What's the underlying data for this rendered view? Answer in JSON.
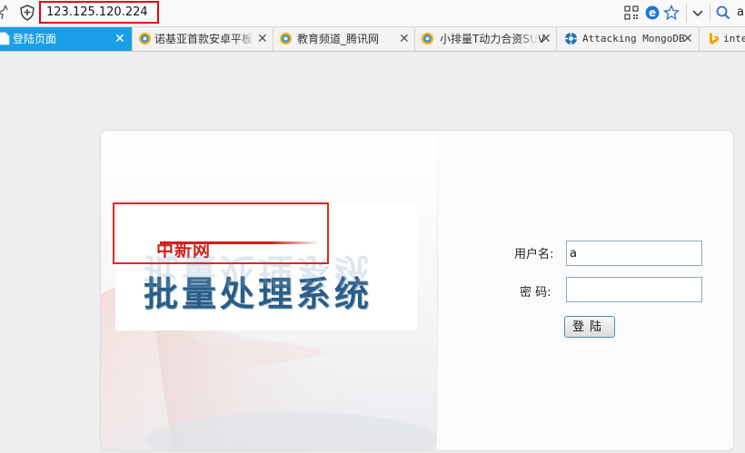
{
  "addressbar": {
    "url": "123.125.120.224",
    "search_text": "a"
  },
  "tabs": [
    {
      "label": "登陆页面",
      "icon": "page-icon",
      "active": true
    },
    {
      "label": "诺基亚首款安卓平板",
      "icon": "360-browser-icon",
      "active": false
    },
    {
      "label": "教育频道_腾讯网",
      "icon": "360-browser-icon",
      "active": false
    },
    {
      "label": "小排量T动力合资SUV",
      "icon": "360-browser-icon",
      "active": false
    },
    {
      "label": "Attacking MongoDB",
      "icon": "gear-logo-icon",
      "active": false
    },
    {
      "label": "inte",
      "icon": "bing-icon",
      "active": false
    }
  ],
  "tab_close": "✕",
  "login": {
    "logo_small": "中新网",
    "logo_big": "批量处理系统",
    "username_label": "用户名:",
    "username_value": "a",
    "password_label": "密 码:",
    "password_value": "",
    "submit_label": "登陆"
  },
  "colors": {
    "highlight_red": "#e0281f",
    "active_tab": "#1a9ee6",
    "logo_blue": "#2a5d87",
    "logo_red": "#d61f1a"
  }
}
